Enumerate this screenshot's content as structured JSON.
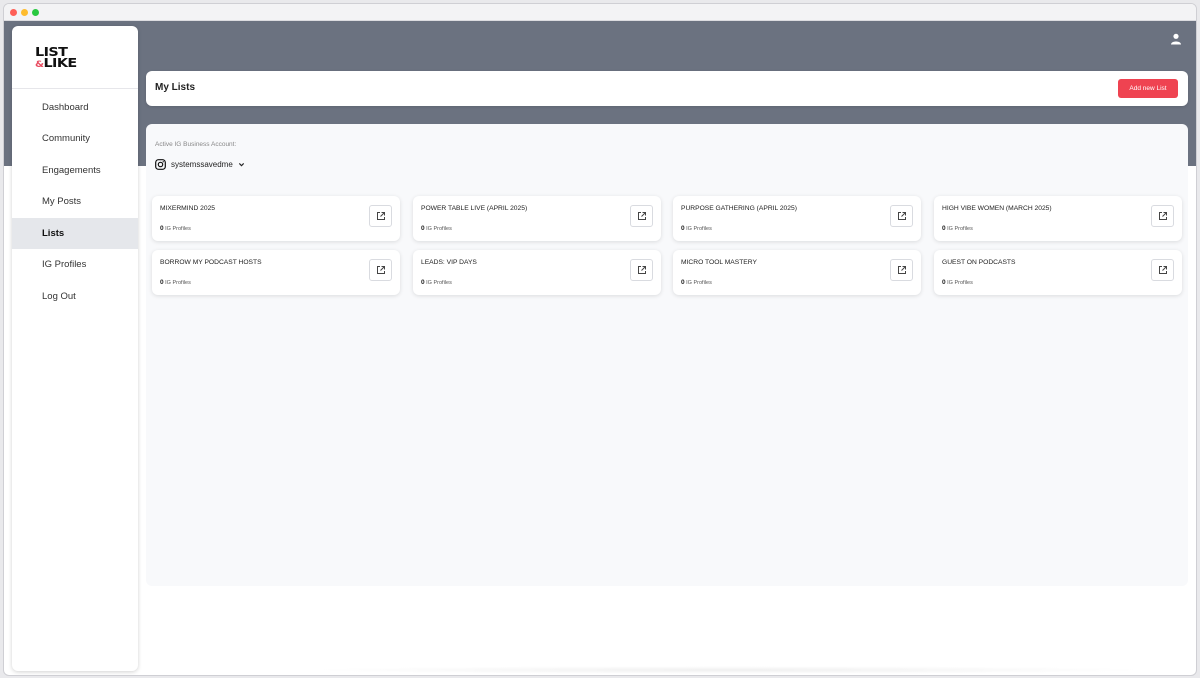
{
  "app": {
    "logo_line1": "LIST",
    "logo_amp": "&",
    "logo_line2": "LIKE"
  },
  "sidebar": {
    "items": [
      {
        "label": "Dashboard"
      },
      {
        "label": "Community"
      },
      {
        "label": "Engagements"
      },
      {
        "label": "My Posts"
      },
      {
        "label": "Lists",
        "active": true
      },
      {
        "label": "IG Profiles"
      },
      {
        "label": "Log Out"
      }
    ]
  },
  "header": {
    "title": "My Lists",
    "add_button": "Add new List"
  },
  "account": {
    "label": "Active IG Business Account:",
    "name": "systemssavedme"
  },
  "lists": [
    {
      "title": "MIXERMIND 2025",
      "count": "0",
      "count_suffix": " IG Profiles"
    },
    {
      "title": "POWER TABLE LIVE (APRIL 2025)",
      "count": "0",
      "count_suffix": " IG Profiles"
    },
    {
      "title": "PURPOSE GATHERING (APRIL 2025)",
      "count": "0",
      "count_suffix": " IG Profiles"
    },
    {
      "title": "HIGH VIBE WOMEN (MARCH 2025)",
      "count": "0",
      "count_suffix": " IG Profiles"
    },
    {
      "title": "BORROW MY PODCAST HOSTS",
      "count": "0",
      "count_suffix": " IG Profiles"
    },
    {
      "title": "LEADS: VIP DAYS",
      "count": "0",
      "count_suffix": " IG Profiles"
    },
    {
      "title": "MICRO TOOL MASTERY",
      "count": "0",
      "count_suffix": " IG Profiles"
    },
    {
      "title": "GUEST ON PODCASTS",
      "count": "0",
      "count_suffix": " IG Profiles"
    }
  ],
  "colors": {
    "hero": "#6b7280",
    "accent": "#ef4351",
    "active_nav": "#e5e7eb"
  },
  "icons": {
    "user": "user-icon",
    "instagram": "instagram-icon",
    "chevron": "chevron-down-icon",
    "open": "external-link-icon"
  }
}
